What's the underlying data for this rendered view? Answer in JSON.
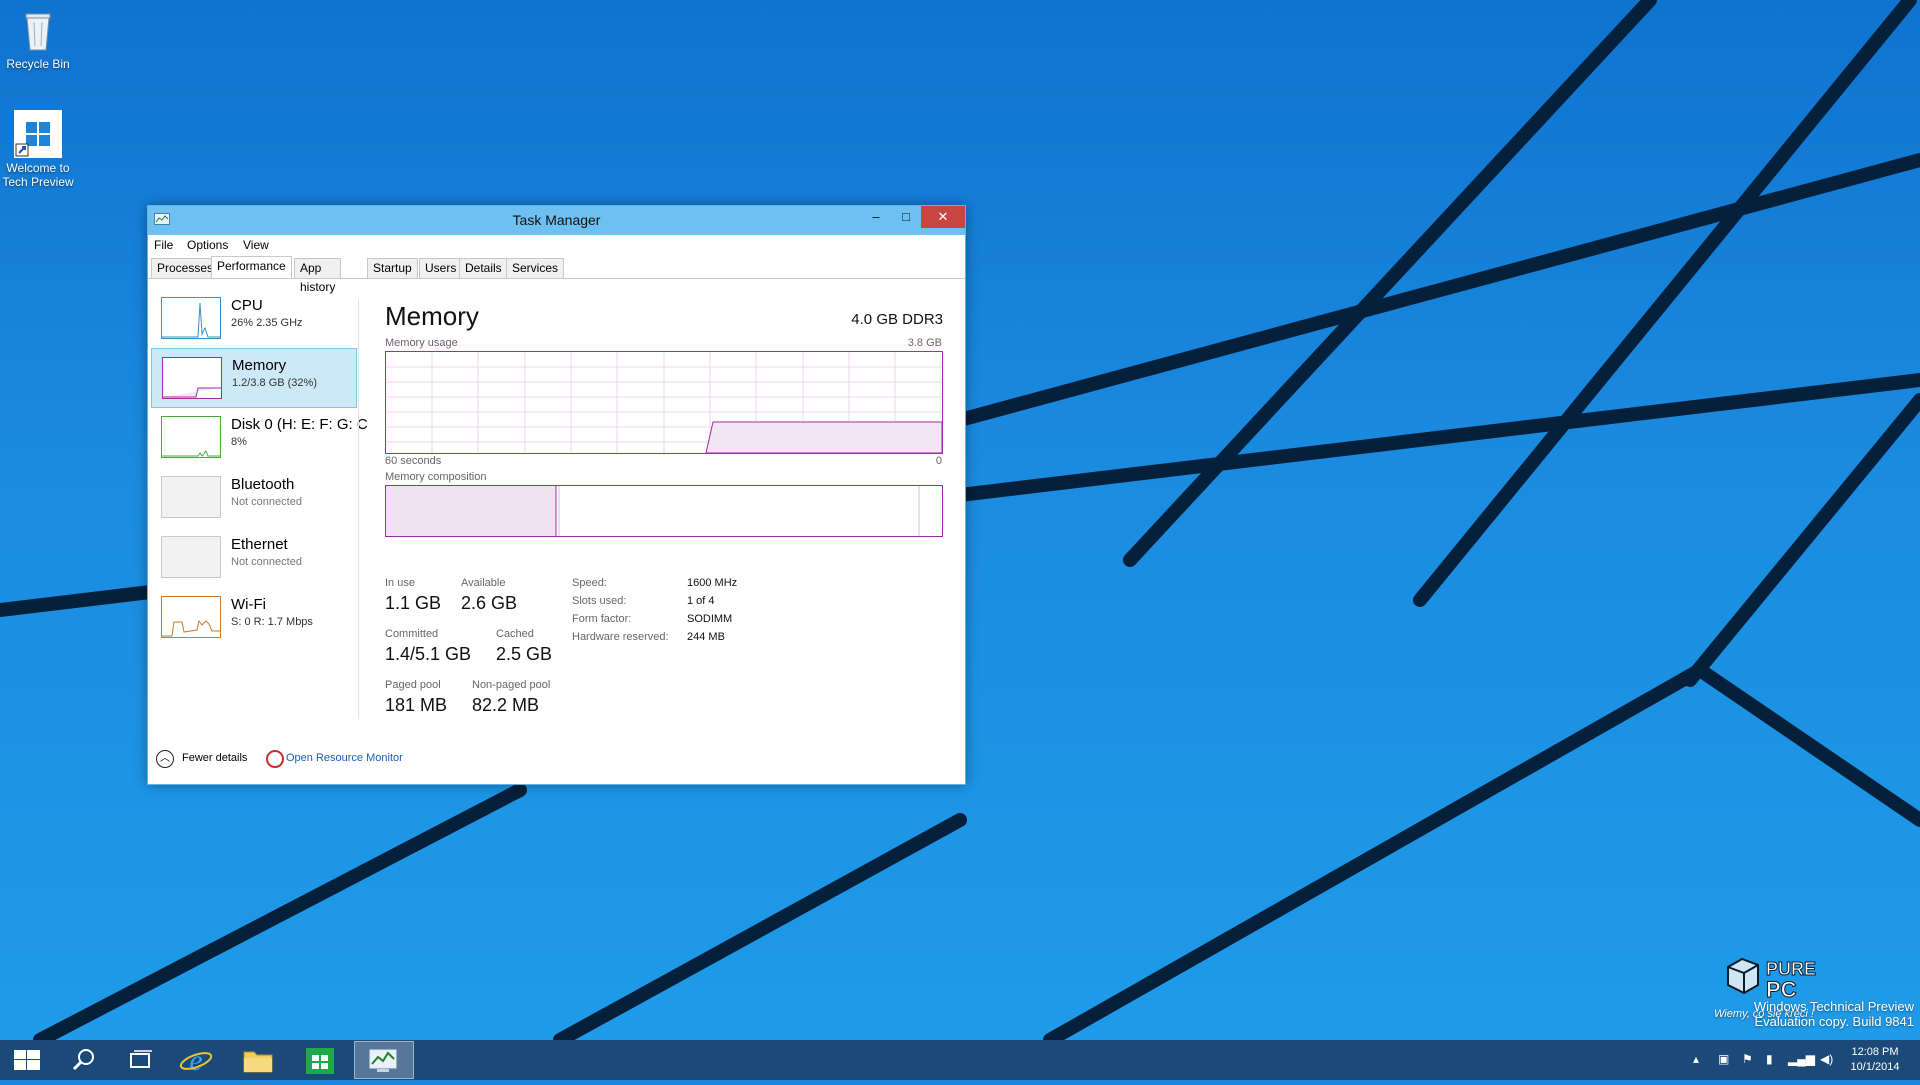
{
  "desktop": {
    "icons": [
      {
        "label": "Recycle Bin"
      },
      {
        "label": "Welcome to Tech Preview"
      }
    ],
    "watermark": {
      "logo": "PURE PC",
      "slogan": "Wiemy, co się kręci !",
      "line1": "Windows Technical Preview",
      "line2": "Evaluation copy. Build 9841"
    }
  },
  "window": {
    "title": "Task Manager",
    "controls": {
      "minimize": "–",
      "maximize": "□",
      "close": "✕"
    },
    "menu": [
      "File",
      "Options",
      "View"
    ],
    "tabs": [
      "Processes",
      "Performance",
      "App history",
      "Startup",
      "Users",
      "Details",
      "Services"
    ],
    "active_tab": "Performance",
    "sidebar": [
      {
        "title": "CPU",
        "subtitle": "26% 2.35 GHz",
        "icon": "cpu-graph"
      },
      {
        "title": "Memory",
        "subtitle": "1.2/3.8 GB (32%)",
        "icon": "memory-graph"
      },
      {
        "title": "Disk 0 (H: E: F: G: C",
        "subtitle": "8%",
        "icon": "disk-graph"
      },
      {
        "title": "Bluetooth",
        "subtitle": "Not connected",
        "icon": "bluetooth-graph"
      },
      {
        "title": "Ethernet",
        "subtitle": "Not connected",
        "icon": "ethernet-graph"
      },
      {
        "title": "Wi-Fi",
        "subtitle": "S: 0 R: 1.7 Mbps",
        "icon": "wifi-graph"
      }
    ],
    "memory": {
      "title": "Memory",
      "type": "4.0 GB DDR3",
      "usage_label": "Memory usage",
      "usage_max": "3.8 GB",
      "time_left": "60 seconds",
      "time_right": "0",
      "composition_label": "Memory composition",
      "stats": {
        "in_use_label": "In use",
        "in_use": "1.1 GB",
        "available_label": "Available",
        "available": "2.6 GB",
        "committed_label": "Committed",
        "committed": "1.4/5.1 GB",
        "cached_label": "Cached",
        "cached": "2.5 GB",
        "paged_label": "Paged pool",
        "paged": "181 MB",
        "nonpaged_label": "Non-paged pool",
        "nonpaged": "82.2 MB"
      },
      "specs": {
        "speed_label": "Speed:",
        "speed": "1600 MHz",
        "slots_label": "Slots used:",
        "slots": "1 of 4",
        "form_label": "Form factor:",
        "form": "SODIMM",
        "reserved_label": "Hardware reserved:",
        "reserved": "244 MB"
      }
    },
    "footer": {
      "fewer_details": "Fewer details",
      "open_resource_monitor": "Open Resource Monitor"
    }
  },
  "taskbar": {
    "apps": [
      "start",
      "search",
      "task-view",
      "internet-explorer",
      "file-explorer",
      "store",
      "task-manager"
    ],
    "active_app": "task-manager",
    "clock": {
      "time": "12:08 PM",
      "date": "10/1/2014"
    },
    "colors": {
      "taskbar": "#1c4a78",
      "accent": "#6ec0f0",
      "memory": "#9b2ea6"
    }
  }
}
